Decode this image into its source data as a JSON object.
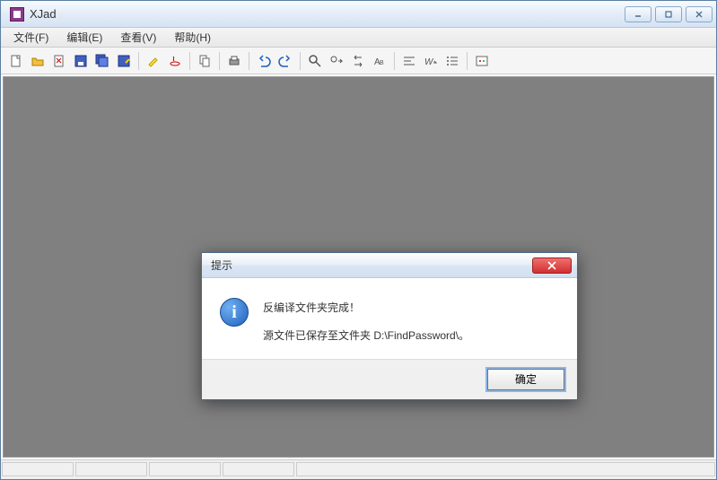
{
  "window": {
    "title": "XJad"
  },
  "menu": {
    "file": "文件(F)",
    "edit": "编辑(E)",
    "view": "查看(V)",
    "help": "帮助(H)"
  },
  "toolbar_icons": [
    "new-file-icon",
    "open-file-icon",
    "close-icon",
    "save-icon",
    "save-all-icon",
    "save-as-icon",
    "sep",
    "highlight-icon",
    "java-icon",
    "sep",
    "copy-icon",
    "sep",
    "print-icon",
    "sep",
    "undo-icon",
    "redo-icon",
    "sep",
    "find-icon",
    "find-next-icon",
    "replace-icon",
    "goto-icon",
    "sep",
    "align-left-icon",
    "word-wrap-icon",
    "list-icon",
    "sep",
    "settings-icon"
  ],
  "dialog": {
    "title": "提示",
    "line1": "反编译文件夹完成！",
    "line2": "源文件已保存至文件夹 D:\\FindPassword\\。",
    "ok": "确定",
    "icon_glyph": "i"
  }
}
